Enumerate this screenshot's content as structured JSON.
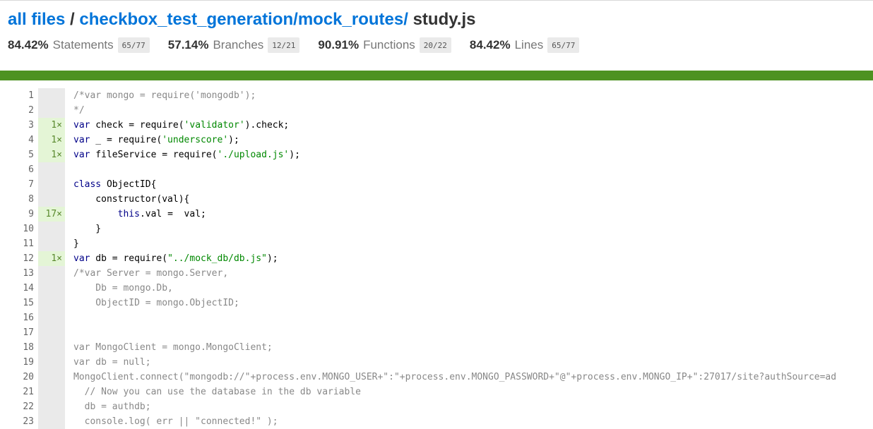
{
  "breadcrumb": {
    "root_label": "all files",
    "separator": " / ",
    "path_label": "checkbox_test_generation/mock_routes/",
    "file": " study.js"
  },
  "stats": [
    {
      "pct": "84.42%",
      "label": "Statements",
      "frac": "65/77"
    },
    {
      "pct": "57.14%",
      "label": "Branches",
      "frac": "12/21"
    },
    {
      "pct": "90.91%",
      "label": "Functions",
      "frac": "20/22"
    },
    {
      "pct": "84.42%",
      "label": "Lines",
      "frac": "65/77"
    }
  ],
  "coverage_bar_color": "#4d9221",
  "code_lines": [
    {
      "n": "1",
      "c": "",
      "hit": false,
      "seg": [
        {
          "t": "/*var mongo = require('mongodb');",
          "k": "cm"
        }
      ]
    },
    {
      "n": "2",
      "c": "",
      "hit": false,
      "seg": [
        {
          "t": "*/",
          "k": "cm"
        }
      ]
    },
    {
      "n": "3",
      "c": "1×",
      "hit": true,
      "seg": [
        {
          "t": "var",
          "k": "kw"
        },
        {
          "t": " check = require(",
          "k": "pl"
        },
        {
          "t": "'validator'",
          "k": "str"
        },
        {
          "t": ").check;",
          "k": "pl"
        }
      ]
    },
    {
      "n": "4",
      "c": "1×",
      "hit": true,
      "seg": [
        {
          "t": "var",
          "k": "kw"
        },
        {
          "t": " _ = require(",
          "k": "pl"
        },
        {
          "t": "'underscore'",
          "k": "str"
        },
        {
          "t": ");",
          "k": "pl"
        }
      ]
    },
    {
      "n": "5",
      "c": "1×",
      "hit": true,
      "seg": [
        {
          "t": "var",
          "k": "kw"
        },
        {
          "t": " fileService = require(",
          "k": "pl"
        },
        {
          "t": "'./upload.js'",
          "k": "str"
        },
        {
          "t": ");",
          "k": "pl"
        }
      ]
    },
    {
      "n": "6",
      "c": "",
      "hit": false,
      "seg": []
    },
    {
      "n": "7",
      "c": "",
      "hit": false,
      "seg": [
        {
          "t": "class",
          "k": "kw"
        },
        {
          "t": " ObjectID{",
          "k": "pl"
        }
      ]
    },
    {
      "n": "8",
      "c": "",
      "hit": false,
      "seg": [
        {
          "t": "    constructor(val){",
          "k": "pl"
        }
      ]
    },
    {
      "n": "9",
      "c": "17×",
      "hit": true,
      "seg": [
        {
          "t": "        ",
          "k": "pl"
        },
        {
          "t": "this",
          "k": "kw"
        },
        {
          "t": ".val =  val;",
          "k": "pl"
        }
      ]
    },
    {
      "n": "10",
      "c": "",
      "hit": false,
      "seg": [
        {
          "t": "    }",
          "k": "pl"
        }
      ]
    },
    {
      "n": "11",
      "c": "",
      "hit": false,
      "seg": [
        {
          "t": "}",
          "k": "pl"
        }
      ]
    },
    {
      "n": "12",
      "c": "1×",
      "hit": true,
      "seg": [
        {
          "t": "var",
          "k": "kw"
        },
        {
          "t": " db = require(",
          "k": "pl"
        },
        {
          "t": "\"../mock_db/db.js\"",
          "k": "str"
        },
        {
          "t": ");",
          "k": "pl"
        }
      ]
    },
    {
      "n": "13",
      "c": "",
      "hit": false,
      "seg": [
        {
          "t": "/*var Server = mongo.Server,",
          "k": "cm"
        }
      ]
    },
    {
      "n": "14",
      "c": "",
      "hit": false,
      "seg": [
        {
          "t": "    Db = mongo.Db,",
          "k": "cm"
        }
      ]
    },
    {
      "n": "15",
      "c": "",
      "hit": false,
      "seg": [
        {
          "t": "    ObjectID = mongo.ObjectID;",
          "k": "cm"
        }
      ]
    },
    {
      "n": "16",
      "c": "",
      "hit": false,
      "seg": []
    },
    {
      "n": "17",
      "c": "",
      "hit": false,
      "seg": []
    },
    {
      "n": "18",
      "c": "",
      "hit": false,
      "seg": [
        {
          "t": "var MongoClient = mongo.MongoClient;",
          "k": "cm"
        }
      ]
    },
    {
      "n": "19",
      "c": "",
      "hit": false,
      "seg": [
        {
          "t": "var db = null;",
          "k": "cm"
        }
      ]
    },
    {
      "n": "20",
      "c": "",
      "hit": false,
      "seg": [
        {
          "t": "MongoClient.connect(\"mongodb://\"+process.env.MONGO_USER+\":\"+process.env.MONGO_PASSWORD+\"@\"+process.env.MONGO_IP+\":27017/site?authSource=ad",
          "k": "cm"
        }
      ]
    },
    {
      "n": "21",
      "c": "",
      "hit": false,
      "seg": [
        {
          "t": "  // Now you can use the database in the db variable",
          "k": "cm"
        }
      ]
    },
    {
      "n": "22",
      "c": "",
      "hit": false,
      "seg": [
        {
          "t": "  db = authdb;",
          "k": "cm"
        }
      ]
    },
    {
      "n": "23",
      "c": "",
      "hit": false,
      "seg": [
        {
          "t": "  console.log( err || \"connected!\" );",
          "k": "cm"
        }
      ]
    }
  ]
}
